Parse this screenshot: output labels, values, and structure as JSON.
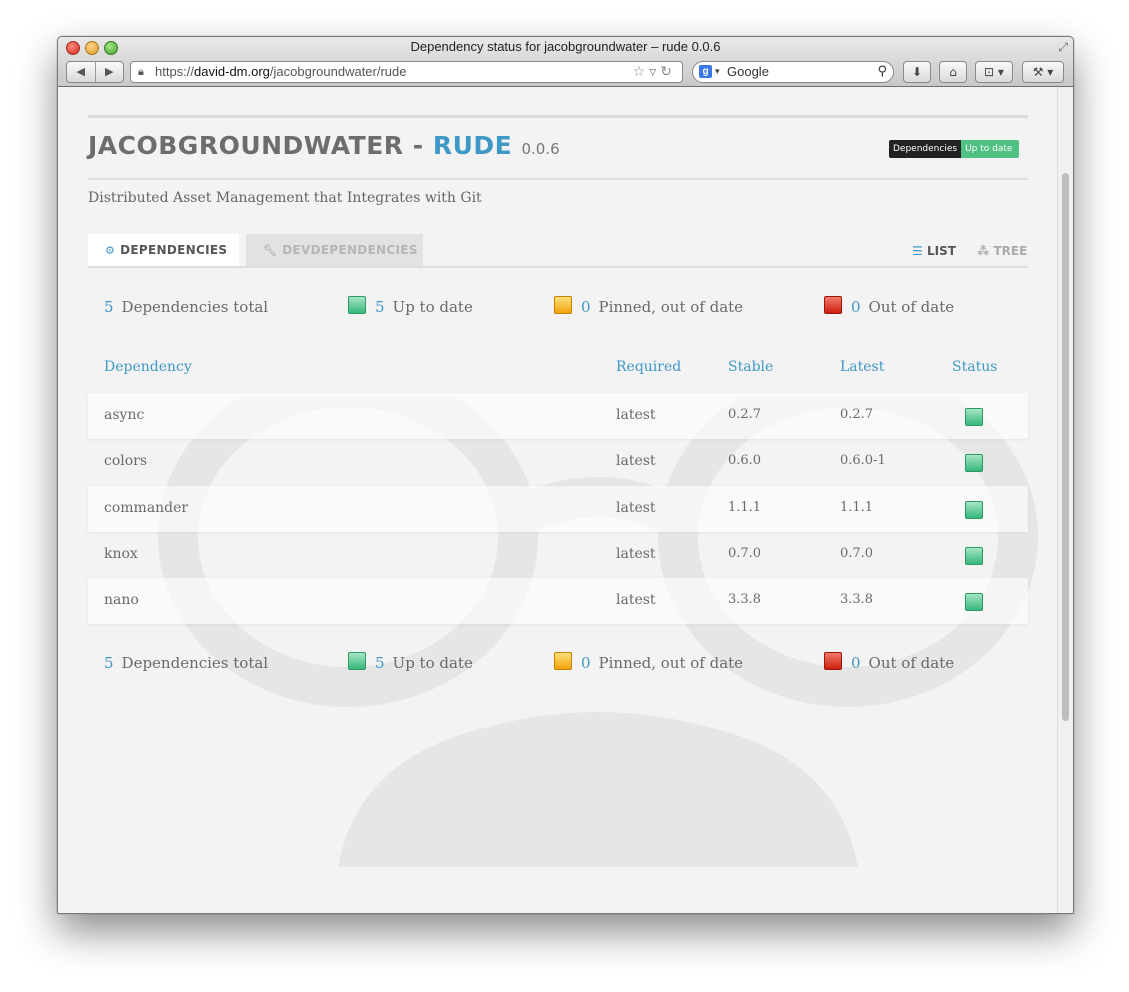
{
  "window": {
    "title": "Dependency status for jacobgroundwater – rude 0.0.6",
    "url_prefix": "https://",
    "url_host": "david-dm.org",
    "url_path": "/jacobgroundwater/rude",
    "search_placeholder": "Google"
  },
  "header": {
    "owner": "JACOBGROUNDWATER",
    "separator": " - ",
    "repo": "RUDE",
    "version": "0.0.6",
    "badge_left": "Dependencies",
    "badge_right": "Up to date",
    "description": "Distributed Asset Management that Integrates with Git"
  },
  "tabs": {
    "dependencies": "DEPENDENCIES",
    "devdependencies": "DEVDEPENDENCIES",
    "list": "LIST",
    "tree": "TREE"
  },
  "summary": {
    "total_count": "5",
    "total_label": "Dependencies total",
    "uptodate_count": "5",
    "uptodate_label": "Up to date",
    "pinned_count": "0",
    "pinned_label": "Pinned, out of date",
    "outofdate_count": "0",
    "outofdate_label": "Out of date"
  },
  "table": {
    "headers": {
      "dependency": "Dependency",
      "required": "Required",
      "stable": "Stable",
      "latest": "Latest",
      "status": "Status"
    },
    "rows": [
      {
        "name": "async",
        "required": "latest",
        "stable": "0.2.7",
        "latest": "0.2.7",
        "status": "up-to-date"
      },
      {
        "name": "colors",
        "required": "latest",
        "stable": "0.6.0",
        "latest": "0.6.0-1",
        "status": "up-to-date"
      },
      {
        "name": "commander",
        "required": "latest",
        "stable": "1.1.1",
        "latest": "1.1.1",
        "status": "up-to-date"
      },
      {
        "name": "knox",
        "required": "latest",
        "stable": "0.7.0",
        "latest": "0.7.0",
        "status": "up-to-date"
      },
      {
        "name": "nano",
        "required": "latest",
        "stable": "3.3.8",
        "latest": "3.3.8",
        "status": "up-to-date"
      }
    ]
  },
  "colors": {
    "accent": "#3f98c5",
    "status_up_to_date": "#35b77a",
    "status_pinned": "#f2a20a",
    "status_out_of_date": "#cc1f0f"
  }
}
